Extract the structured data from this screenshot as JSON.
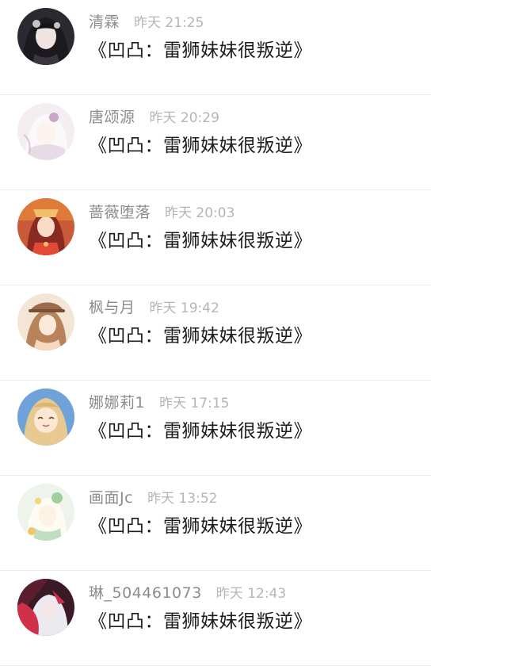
{
  "comments": [
    {
      "username": "清霖",
      "time": "昨天 21:25",
      "message": "《凹凸：雷狮妹妹很叛逆》",
      "avatar": {
        "icon": "anime-avatar-dark-hair",
        "bg": "#2a2a30",
        "accent": "#c9c2c8"
      }
    },
    {
      "username": "唐颂源",
      "time": "昨天 20:29",
      "message": "《凹凸：雷狮妹妹很叛逆》",
      "avatar": {
        "icon": "anime-avatar-white-hair",
        "bg": "#f4eef2",
        "accent": "#c9a6c8"
      }
    },
    {
      "username": "蔷薇堕落",
      "time": "昨天 20:03",
      "message": "《凹凸：雷狮妹妹很叛逆》",
      "avatar": {
        "icon": "anime-avatar-red-dress",
        "bg": "#c95a3a",
        "accent": "#f2c06b"
      }
    },
    {
      "username": "枫与月",
      "time": "昨天 19:42",
      "message": "《凹凸：雷狮妹妹很叛逆》",
      "avatar": {
        "icon": "anime-avatar-brown-hat",
        "bg": "#f3e6d6",
        "accent": "#9a6a4a"
      }
    },
    {
      "username": "娜娜莉1",
      "time": "昨天 17:15",
      "message": "《凹凸：雷狮妹妹很叛逆》",
      "avatar": {
        "icon": "anime-avatar-smiling-blonde",
        "bg": "#6fa2d8",
        "accent": "#e8c98f"
      }
    },
    {
      "username": "画面Jc",
      "time": "昨天 13:52",
      "message": "《凹凸：雷狮妹妹很叛逆》",
      "avatar": {
        "icon": "anime-avatar-green-light",
        "bg": "#eef4ec",
        "accent": "#9fcf9a"
      }
    },
    {
      "username": "琳_504461073",
      "time": "昨天 12:43",
      "message": "《凹凸：雷狮妹妹很叛逆》",
      "avatar": {
        "icon": "anime-avatar-red-black",
        "bg": "#3a1a26",
        "accent": "#d0304a"
      }
    }
  ]
}
